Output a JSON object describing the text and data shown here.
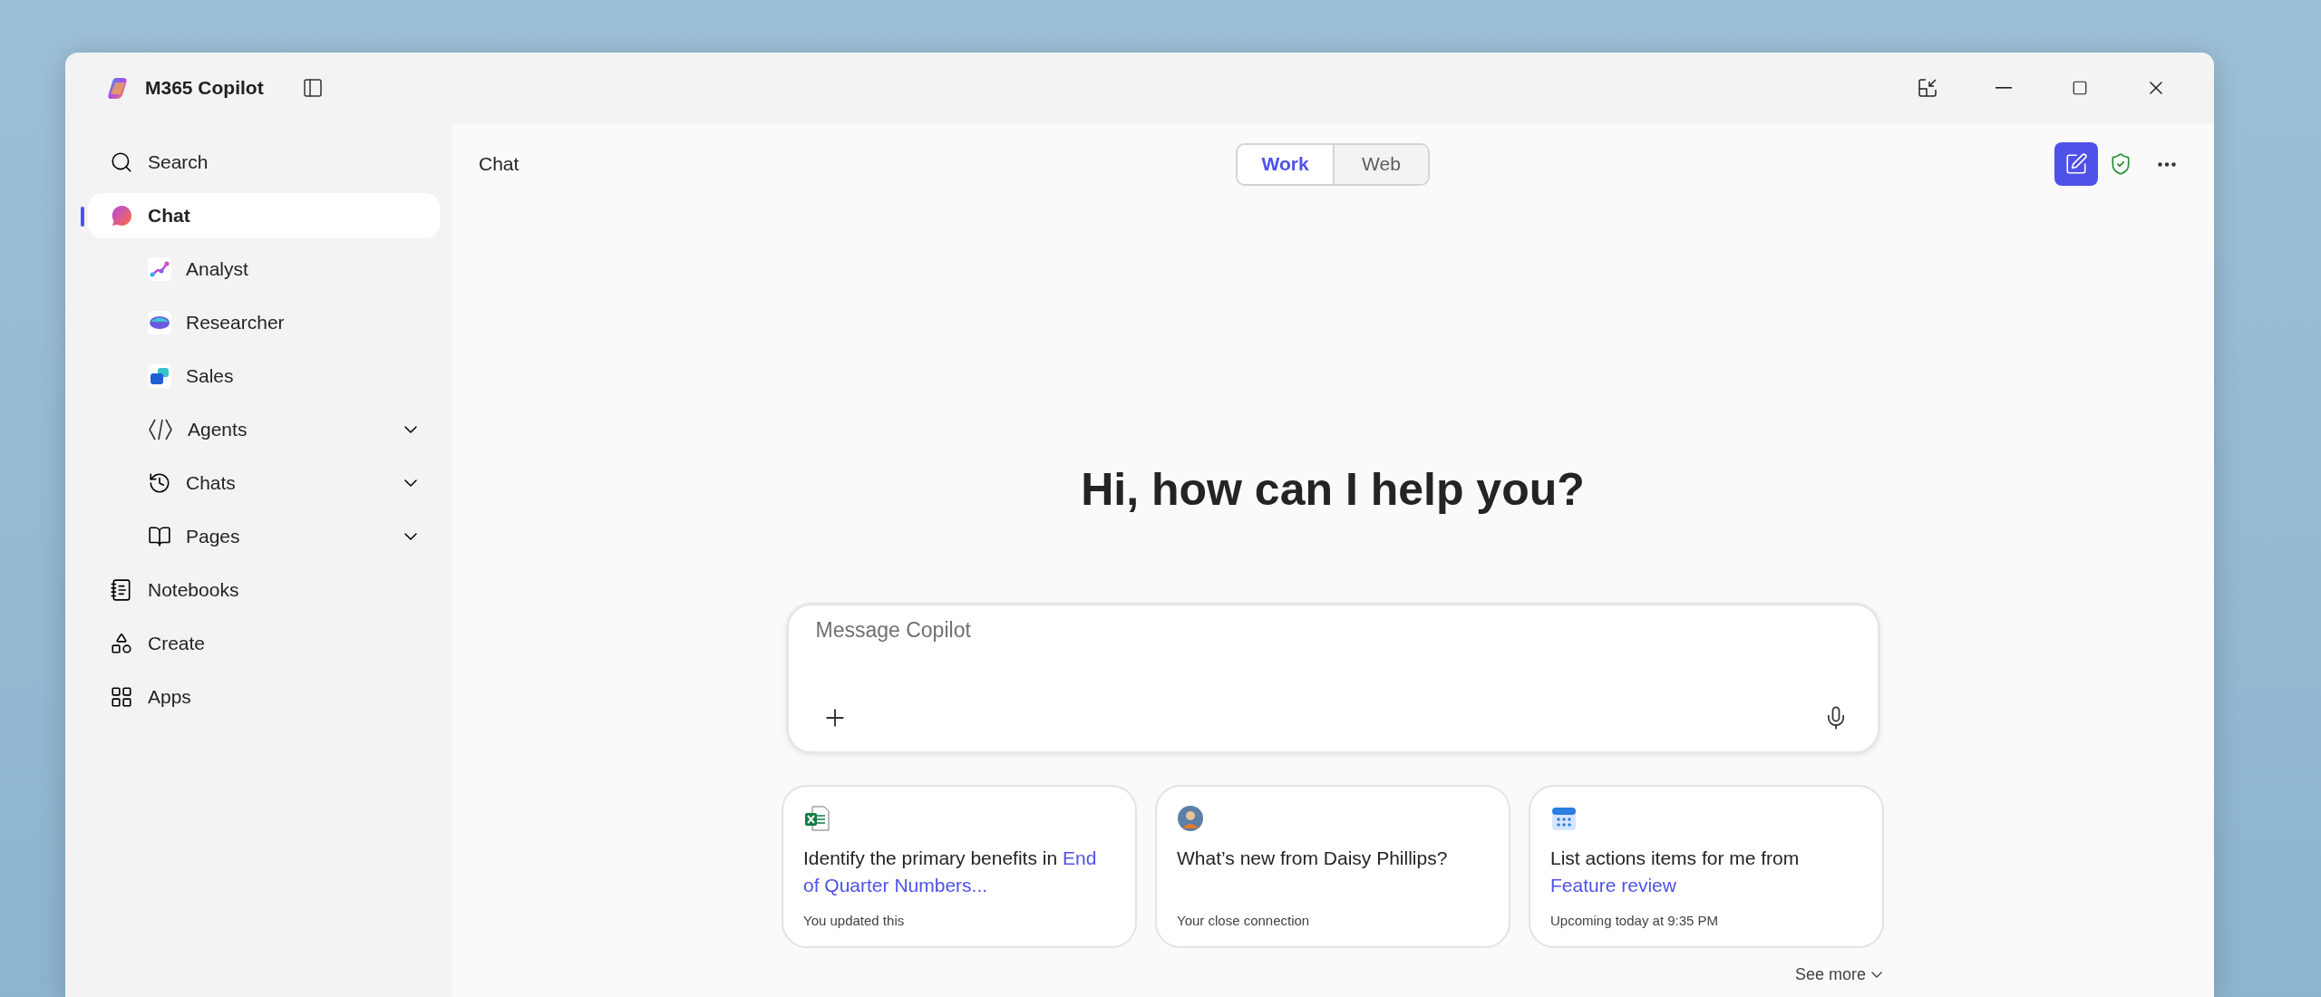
{
  "window": {
    "title": "M365 Copilot"
  },
  "sidebar": {
    "items": [
      {
        "label": "Search",
        "selected": false
      },
      {
        "label": "Chat",
        "selected": true,
        "children": [
          {
            "label": "Analyst",
            "selected": false
          },
          {
            "label": "Researcher",
            "selected": false
          },
          {
            "label": "Sales",
            "selected": false
          },
          {
            "label": "Agents",
            "selected": false,
            "expanded": false
          },
          {
            "label": "Chats",
            "selected": false,
            "expanded": false
          },
          {
            "label": "Pages",
            "selected": false,
            "expanded": false
          }
        ]
      },
      {
        "label": "Notebooks",
        "selected": false
      },
      {
        "label": "Create",
        "selected": false
      },
      {
        "label": "Apps",
        "selected": false
      }
    ]
  },
  "header": {
    "title": "Chat",
    "modes": [
      {
        "label": "Work",
        "selected": true
      },
      {
        "label": "Web",
        "selected": false
      }
    ]
  },
  "greeting": "Hi, how can I help you?",
  "composer": {
    "placeholder": "Message Copilot"
  },
  "suggestions": [
    {
      "kind": "file",
      "prompt": "Identify the primary benefits in",
      "link": "End of Quarter Numbers...",
      "caption": "You updated this"
    },
    {
      "kind": "person",
      "prompt": "What’s new from Daisy Phillips?",
      "caption": "Your close connection"
    },
    {
      "kind": "meeting",
      "prompt": "List actions items for me from",
      "link": "Feature review",
      "caption": "Upcoming today at 9:35 PM"
    }
  ],
  "see_more": "See more"
}
